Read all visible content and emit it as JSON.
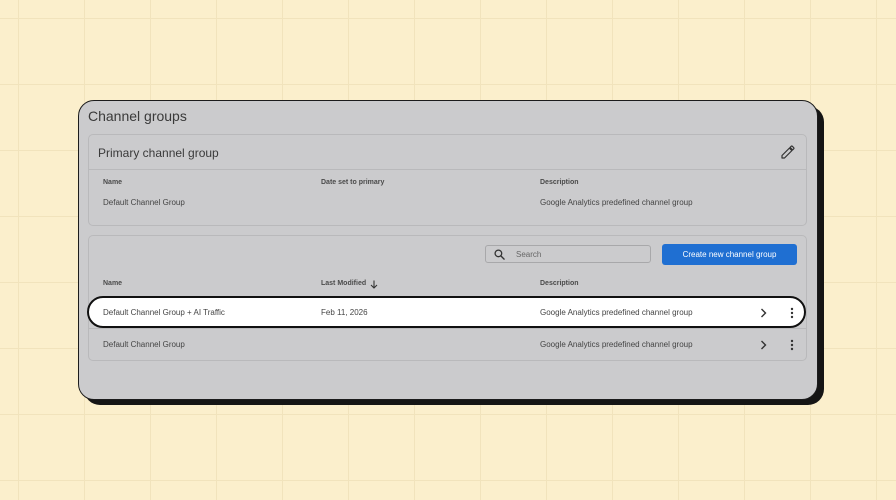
{
  "page": {
    "title": "Channel groups"
  },
  "primary": {
    "title": "Primary channel group",
    "headers": {
      "name": "Name",
      "date": "Date set to primary",
      "description": "Description"
    },
    "row": {
      "name": "Default Channel Group",
      "date": "",
      "description": "Google Analytics predefined channel group"
    }
  },
  "list": {
    "search_placeholder": "Search",
    "create_label": "Create new channel group",
    "headers": {
      "name": "Name",
      "modified": "Last Modified",
      "description": "Description"
    },
    "rows": [
      {
        "name": "Default Channel Group + AI Traffic",
        "modified": "Feb 11, 2026",
        "description": "Google Analytics predefined channel group"
      },
      {
        "name": "Default Channel Group",
        "modified": "",
        "description": "Google Analytics predefined channel group"
      }
    ]
  },
  "icons": [
    "edit-pencil-icon",
    "search-icon",
    "sort-down-arrow-icon",
    "chevron-right-icon",
    "more-vert-icon"
  ],
  "colors": {
    "background": "#fbefcc",
    "card": "#cbcbcd",
    "accent": "#1f6fd2"
  }
}
